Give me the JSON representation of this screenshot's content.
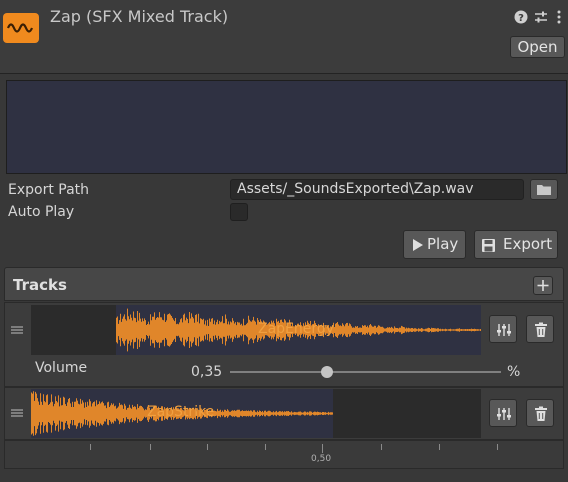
{
  "header": {
    "title": "Zap (SFX Mixed Track)",
    "open_label": "Open",
    "icons": [
      "help-icon",
      "settings-sliders-icon",
      "more-icon"
    ]
  },
  "fields": {
    "export_path_label": "Export Path",
    "export_path_value": "Assets/_SoundsExported\\Zap.wav",
    "auto_play_label": "Auto Play",
    "auto_play_checked": false
  },
  "actions": {
    "play_label": "Play",
    "export_label": "Export"
  },
  "tracks": {
    "title": "Tracks",
    "items": [
      {
        "name": "ZapEnergy",
        "volume_label": "Volume",
        "volume_value": "0,35",
        "volume_unit": "%",
        "volume_fraction": 0.35
      },
      {
        "name": "ZapStrike"
      }
    ]
  },
  "timeline": {
    "tick_label": "0,50"
  },
  "colors": {
    "accent": "#f08a1e",
    "waveform": "#e0862a",
    "preview_bg": "#2f3142"
  }
}
